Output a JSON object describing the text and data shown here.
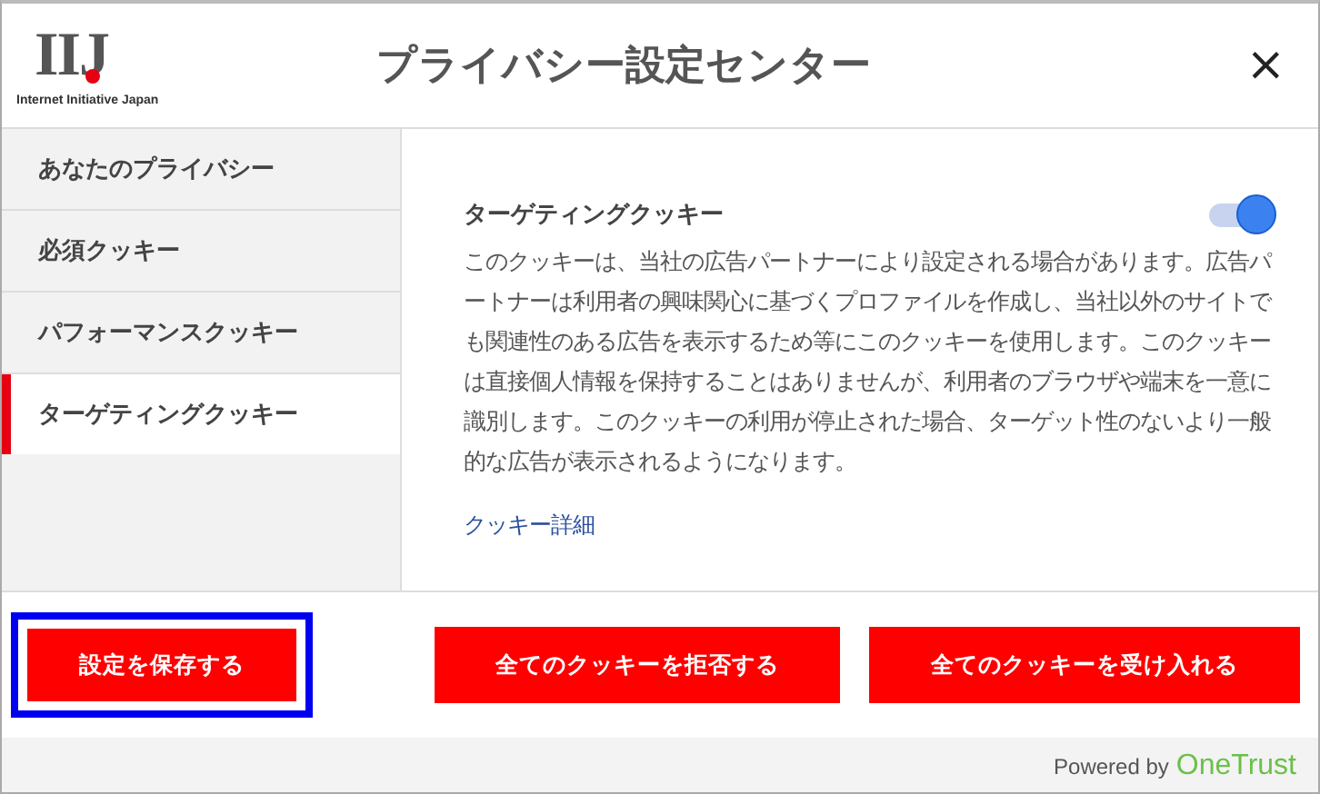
{
  "header": {
    "logo": "IIJ",
    "logo_caption": "Internet Initiative Japan",
    "title": "プライバシー設定センター",
    "close": "×"
  },
  "sidebar": {
    "items": [
      {
        "label": "あなたのプライバシー",
        "selected": false
      },
      {
        "label": "必須クッキー",
        "selected": false
      },
      {
        "label": "パフォーマンスクッキー",
        "selected": false
      },
      {
        "label": "ターゲティングクッキー",
        "selected": true
      }
    ]
  },
  "detail": {
    "heading": "ターゲティングクッキー",
    "toggle": {
      "on": true
    },
    "description": "このクッキーは、当社の広告パートナーにより設定される場合があります。広告パートナーは利用者の興味関心に基づくプロファイルを作成し、当社以外のサイトでも関連性のある広告を表示するため等にこのクッキーを使用します。このクッキーは直接個人情報を保持することはありませんが、利用者のブラウザや端末を一意に識別します。このクッキーの利用が停止された場合、ターゲット性のないより一般的な広告が表示されるようになります。",
    "link": "クッキー詳細"
  },
  "buttons": [
    {
      "label": "設定を保存する",
      "focused": true
    },
    {
      "label": "全てのクッキーを拒否する",
      "focused": false
    },
    {
      "label": "全てのクッキーを受け入れる",
      "focused": false
    }
  ],
  "footer": {
    "powered_by": "Powered by",
    "brand": "OneTrust"
  }
}
